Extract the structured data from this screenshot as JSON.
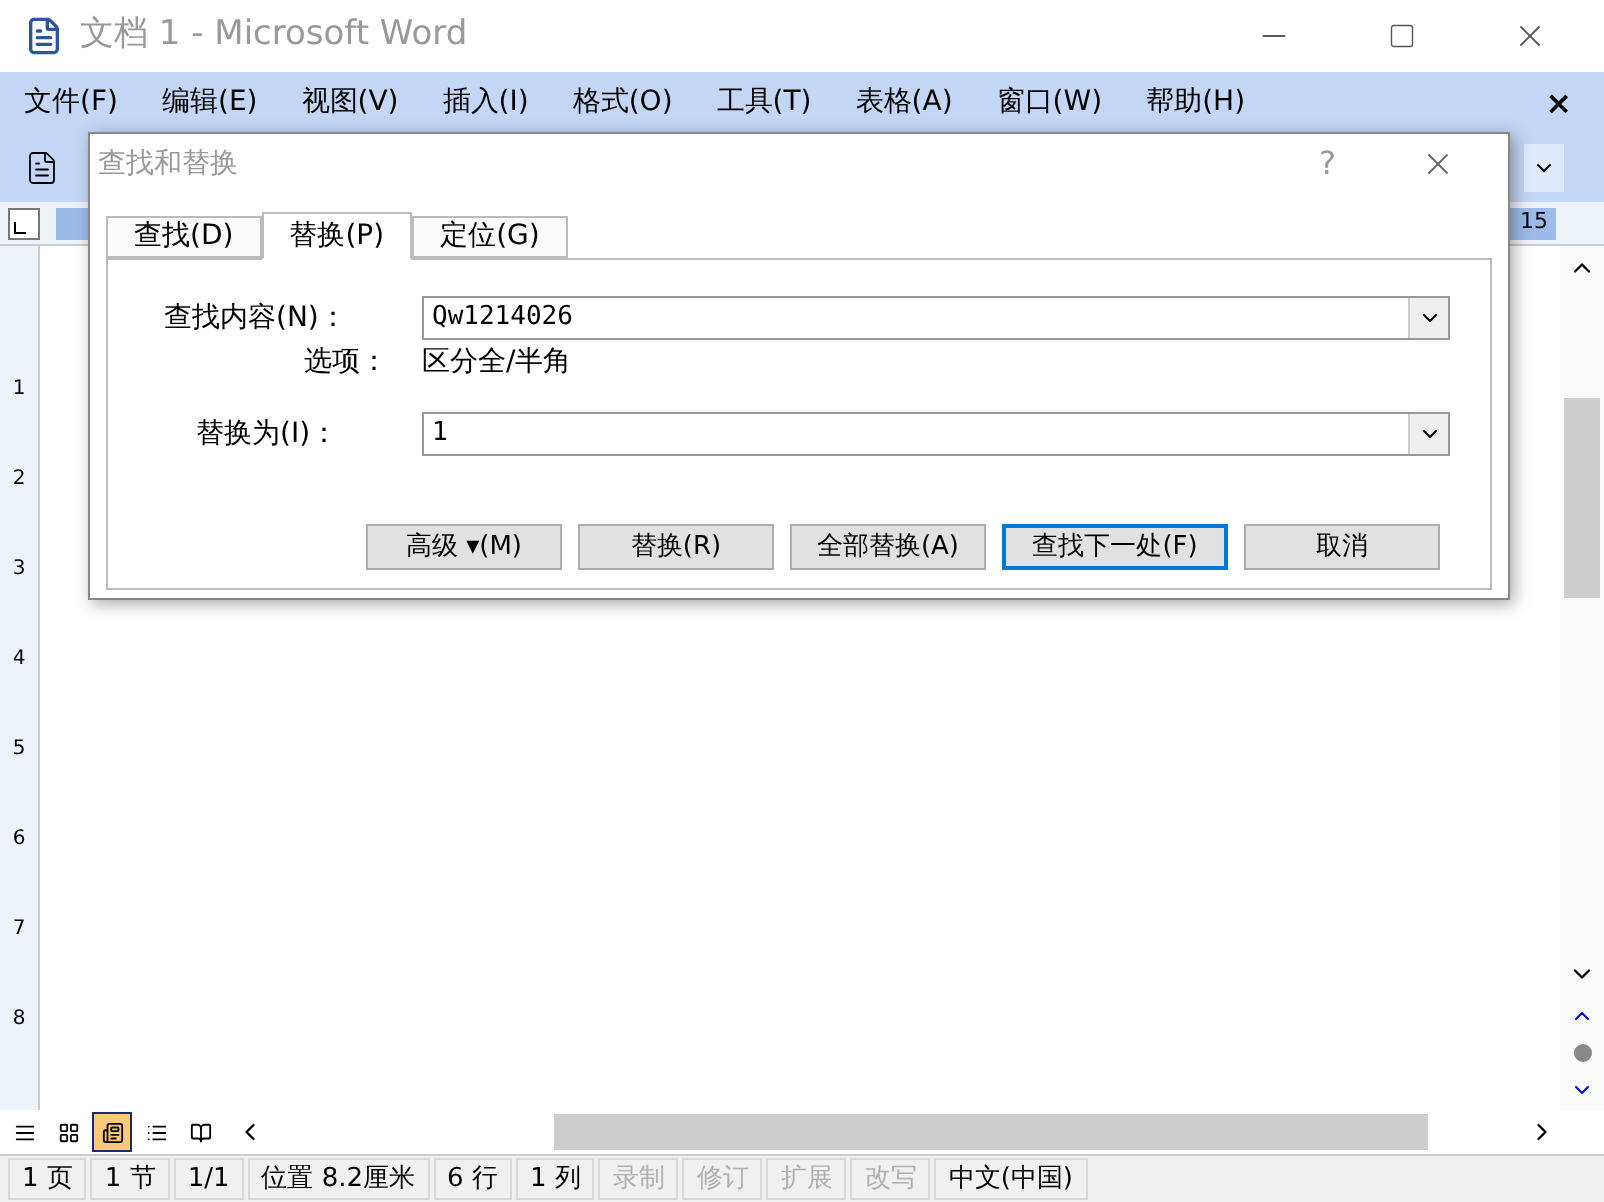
{
  "window": {
    "title": "文档 1 - Microsoft Word"
  },
  "menu": [
    "文件(F)",
    "编辑(E)",
    "视图(V)",
    "插入(I)",
    "格式(O)",
    "工具(T)",
    "表格(A)",
    "窗口(W)",
    "帮助(H)"
  ],
  "menu_close": "×",
  "ruler": {
    "mark": "15"
  },
  "vertical_ruler": [
    "1",
    "2",
    "3",
    "4",
    "5",
    "6",
    "7",
    "8"
  ],
  "dialog": {
    "title": "查找和替换",
    "help": "?",
    "tabs": [
      {
        "label": "查找(D)",
        "selected": false
      },
      {
        "label": "替换(P)",
        "selected": true
      },
      {
        "label": "定位(G)",
        "selected": false
      }
    ],
    "find": {
      "label": "查找内容(N)：",
      "value": "Qw1214026"
    },
    "options": {
      "label": "选项：",
      "value": "区分全/半角"
    },
    "replace": {
      "label": "替换为(I)：",
      "value": "1"
    },
    "buttons": [
      {
        "label": "高级 ▾(M)",
        "selected": false
      },
      {
        "label": "替换(R)",
        "selected": false
      },
      {
        "label": "全部替换(A)",
        "selected": false
      },
      {
        "label": "查找下一处(F)",
        "selected": true
      },
      {
        "label": "取消",
        "selected": false
      }
    ]
  },
  "view_buttons": [
    {
      "selected": false
    },
    {
      "selected": false
    },
    {
      "selected": true
    },
    {
      "selected": false
    },
    {
      "selected": false
    }
  ],
  "status_bar": [
    {
      "text": "1 页",
      "disabled": false
    },
    {
      "text": "1 节",
      "disabled": false
    },
    {
      "text": "1/1",
      "disabled": false
    },
    {
      "text": "位置 8.2厘米",
      "disabled": false
    },
    {
      "text": "6 行",
      "disabled": false
    },
    {
      "text": "1 列",
      "disabled": false
    },
    {
      "text": "录制",
      "disabled": true
    },
    {
      "text": "修订",
      "disabled": true
    },
    {
      "text": "扩展",
      "disabled": true
    },
    {
      "text": "改写",
      "disabled": true
    },
    {
      "text": "中文(中国)",
      "disabled": false
    }
  ]
}
